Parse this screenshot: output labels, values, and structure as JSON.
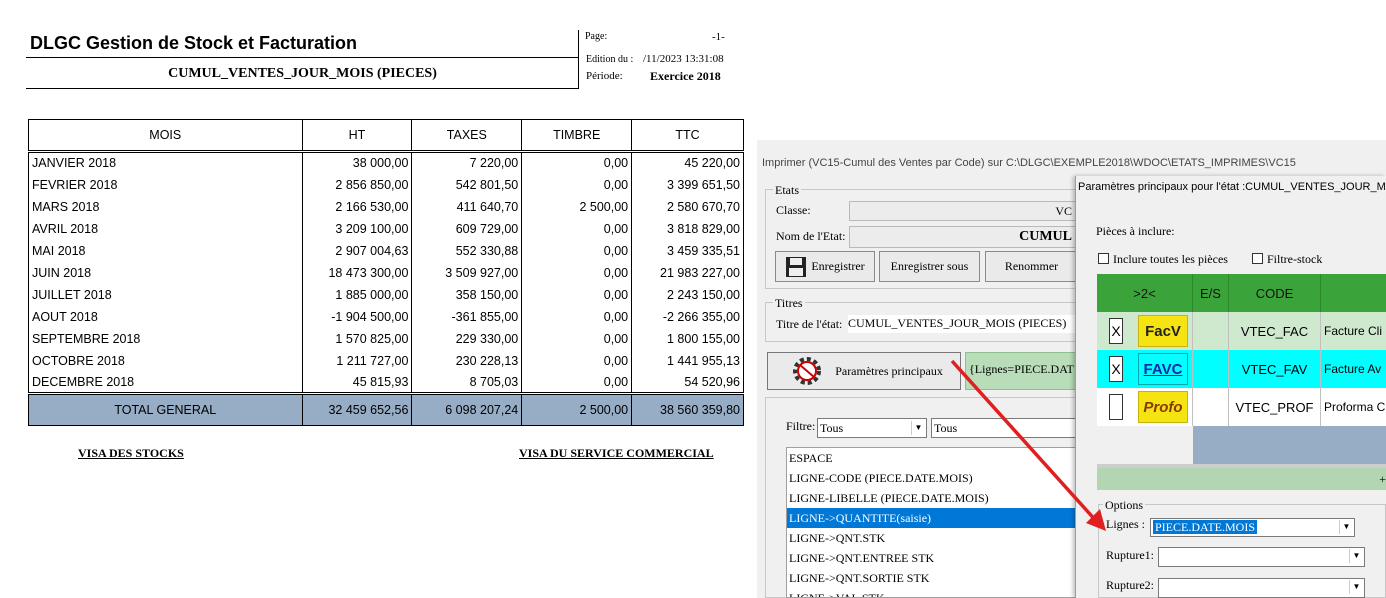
{
  "report": {
    "title": "DLGC Gestion de Stock et Facturation",
    "subtitle": "CUMUL_VENTES_JOUR_MOIS (PIECES)",
    "page_label": "Page:",
    "page_value": "-1-",
    "edition_label": "Edition du :",
    "edition_value": "/11/2023 13:31:08",
    "periode_label": "Période:",
    "periode_value": "Exercice 2018",
    "columns": [
      "MOIS",
      "HT",
      "TAXES",
      "TIMBRE",
      "TTC"
    ],
    "rows": [
      [
        "JANVIER 2018",
        "38 000,00",
        "7 220,00",
        "0,00",
        "45 220,00"
      ],
      [
        "FEVRIER 2018",
        "2 856 850,00",
        "542 801,50",
        "0,00",
        "3 399 651,50"
      ],
      [
        "MARS 2018",
        "2 166 530,00",
        "411 640,70",
        "2 500,00",
        "2 580 670,70"
      ],
      [
        "AVRIL 2018",
        "3 209 100,00",
        "609 729,00",
        "0,00",
        "3 818 829,00"
      ],
      [
        "MAI 2018",
        "2 907 004,63",
        "552 330,88",
        "0,00",
        "3 459 335,51"
      ],
      [
        "JUIN 2018",
        "18 473 300,00",
        "3 509 927,00",
        "0,00",
        "21 983 227,00"
      ],
      [
        "JUILLET 2018",
        "1 885 000,00",
        "358 150,00",
        "0,00",
        "2 243 150,00"
      ],
      [
        "AOUT 2018",
        "-1 904 500,00",
        "-361 855,00",
        "0,00",
        "-2 266 355,00"
      ],
      [
        "SEPTEMBRE 2018",
        "1 570 825,00",
        "229 330,00",
        "0,00",
        "1 800 155,00"
      ],
      [
        "OCTOBRE 2018",
        "1 211 727,00",
        "230 228,13",
        "0,00",
        "1 441 955,13"
      ],
      [
        "DECEMBRE 2018",
        "45 815,93",
        "8 705,03",
        "0,00",
        "54 520,96"
      ]
    ],
    "total": [
      "TOTAL GENERAL",
      "32 459 652,56",
      "6 098 207,24",
      "2 500,00",
      "38 560 359,80"
    ],
    "visa_stocks": "VISA DES STOCKS",
    "visa_commercial": "VISA DU SERVICE COMMERCIAL"
  },
  "dialog": {
    "title": "Imprimer (VC15-Cumul des Ventes par Code)  sur C:\\DLGC\\EXEMPLE2018\\WDOC\\ETATS_IMPRIMES\\VC15",
    "etats_label": "Etats",
    "classe_label": "Classe:",
    "classe_value": "VC",
    "nom_label": "Nom de l'Etat:",
    "nom_value": "CUMUL",
    "btn_enregistrer": "Enregistrer",
    "btn_enregistrer_sous": "Enregistrer sous",
    "btn_renommer": "Renommer",
    "titres_label": "Titres",
    "titre_etat_label": "Titre de l'état:",
    "titre_etat_value": "CUMUL_VENTES_JOUR_MOIS (PIECES)",
    "btn_parametres": "Paramètres principaux",
    "lignes_text": "{Lignes=PIECE.DAT",
    "filtre_label": "Filtre:",
    "filtre_value": "Tous",
    "filtre2_value": "Tous",
    "list_items": [
      "ESPACE",
      "LIGNE-CODE (PIECE.DATE.MOIS)",
      "LIGNE-LIBELLE (PIECE.DATE.MOIS)",
      "LIGNE->QUANTITE(saisie)",
      "LIGNE->QNT.STK",
      "LIGNE->QNT.ENTREE STK",
      "LIGNE->QNT.SORTIE STK",
      "LIGNE->VAL.STK"
    ],
    "selected_index": 3
  },
  "subdialog": {
    "title": "Paramètres principaux pour l'état :CUMUL_VENTES_JOUR_M",
    "pieces_label": "Pièces à inclure:",
    "inclure_label": "Inclure toutes les pièces",
    "filtre_stock_label": "Filtre-stock",
    "grid_headers": [
      ">2<",
      "E/S",
      "CODE",
      ""
    ],
    "grid_rows": [
      {
        "check": "X",
        "badge": "FacV",
        "code": "VTEC_FAC",
        "label": "Facture Cli",
        "bg": "#cfe9cf"
      },
      {
        "check": "X",
        "badge": "FAVC",
        "code": "VTEC_FAV",
        "label": "Facture Av",
        "bg": "#00ffff"
      },
      {
        "check": "",
        "badge": "Profo",
        "code": "VTEC_PROF",
        "label": "Proforma C",
        "bg": "#ffffff"
      }
    ],
    "grid_plus": "+",
    "options_label": "Options",
    "lignes_label": "Lignes :",
    "lignes_value": "PIECE.DATE.MOIS",
    "rupture1_label": "Rupture1:",
    "rupture2_label": "Rupture2:"
  },
  "colors": {
    "accent_green": "#3aa43a",
    "total_row": "#97acc5",
    "selection": "#0078d7",
    "arrow": "#e02020"
  }
}
